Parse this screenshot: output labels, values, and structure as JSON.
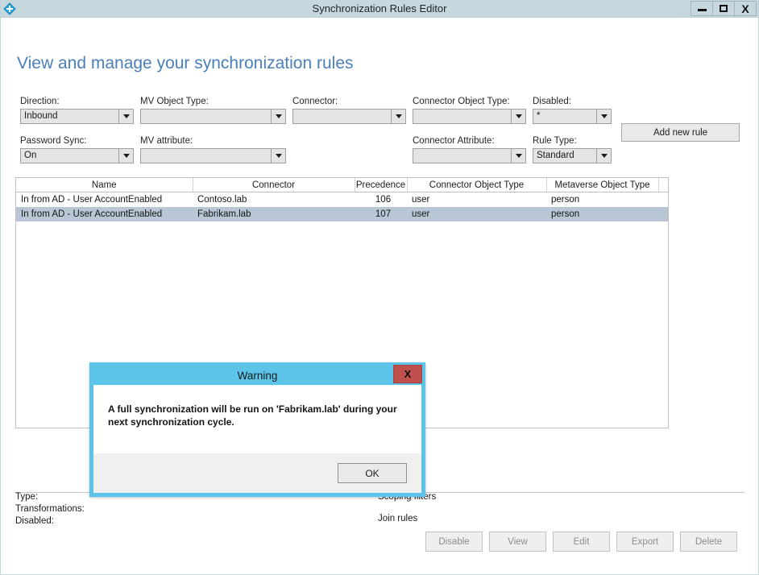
{
  "window": {
    "title": "Synchronization Rules Editor",
    "icon": "sync-diamond-icon",
    "controls": {
      "minimize": "–",
      "maximize": "☐",
      "close": "X"
    }
  },
  "page": {
    "heading": "View and manage your synchronization rules"
  },
  "filters": {
    "row1": [
      {
        "label": "Direction:",
        "value": "Inbound"
      },
      {
        "label": "MV Object Type:",
        "value": ""
      },
      {
        "label": "Connector:",
        "value": ""
      },
      {
        "label": "Connector Object Type:",
        "value": ""
      },
      {
        "label": "Disabled:",
        "value": "*"
      }
    ],
    "row2": [
      {
        "label": "Password Sync:",
        "value": "On"
      },
      {
        "label": "MV attribute:",
        "value": ""
      },
      {
        "label": "Connector Attribute:",
        "value": ""
      },
      {
        "label": "Rule Type:",
        "value": "Standard"
      }
    ]
  },
  "actions": {
    "add_new_rule": "Add new rule"
  },
  "grid": {
    "columns": [
      "Name",
      "Connector",
      "Precedence",
      "Connector Object Type",
      "Metaverse Object Type"
    ],
    "rows": [
      {
        "name": "In from AD - User AccountEnabled",
        "connector": "Contoso.lab",
        "precedence": "106",
        "connector_object_type": "user",
        "metaverse_object_type": "person",
        "selected": false
      },
      {
        "name": "In from AD - User AccountEnabled",
        "connector": "Fabrikam.lab",
        "precedence": "107",
        "connector_object_type": "user",
        "metaverse_object_type": "person",
        "selected": true
      }
    ]
  },
  "details": {
    "left": [
      "Type:",
      "Transformations:",
      "Disabled:"
    ],
    "right": [
      "Scoping filters",
      "Join rules"
    ]
  },
  "footer_buttons": [
    {
      "label": "Disable",
      "enabled": false
    },
    {
      "label": "View",
      "enabled": false
    },
    {
      "label": "Edit",
      "enabled": false
    },
    {
      "label": "Export",
      "enabled": false
    },
    {
      "label": "Delete",
      "enabled": false
    }
  ],
  "dialog": {
    "title": "Warning",
    "close_label": "X",
    "message": "A full synchronization will be run on 'Fabrikam.lab' during your next synchronization cycle.",
    "ok_label": "OK"
  },
  "colors": {
    "titlebar": "#c6d7dd",
    "heading": "#4a7fba",
    "dialog_accent": "#5bc4e8",
    "dialog_close": "#c0504d",
    "row_selected": "#b8c6d6"
  }
}
